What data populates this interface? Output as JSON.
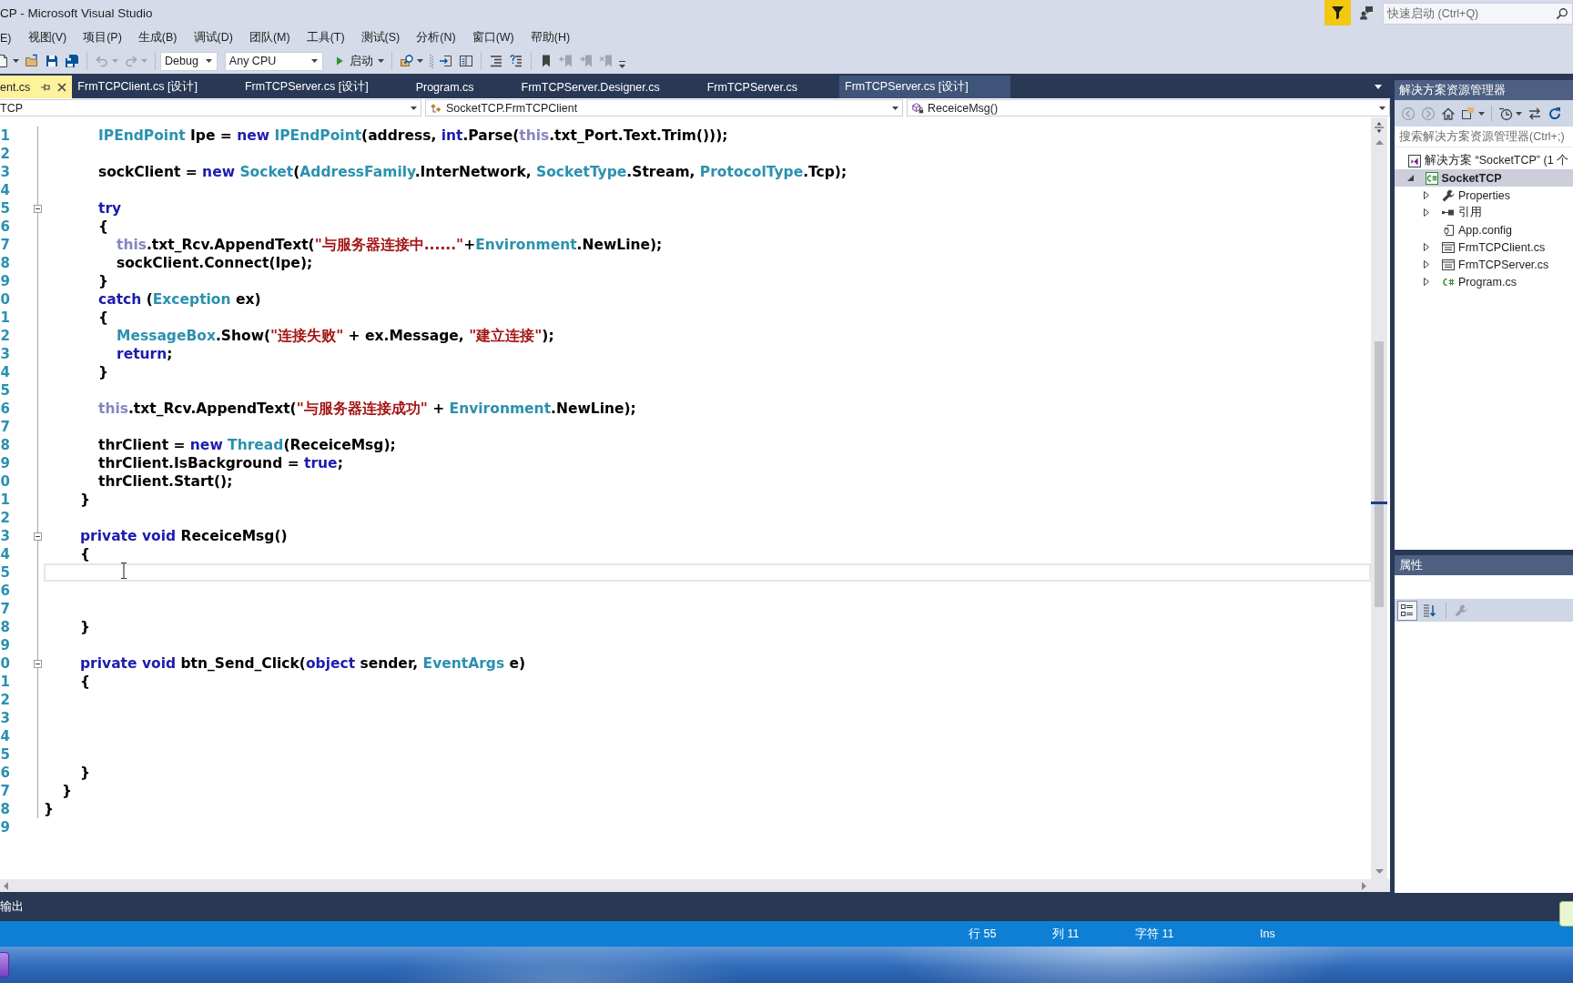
{
  "window": {
    "title": "CP - Microsoft Visual Studio"
  },
  "quick_launch": {
    "placeholder": "快速启动 (Ctrl+Q)"
  },
  "menu": [
    "E)",
    "视图(V)",
    "项目(P)",
    "生成(B)",
    "调试(D)",
    "团队(M)",
    "工具(T)",
    "测试(S)",
    "分析(N)",
    "窗口(W)",
    "帮助(H)"
  ],
  "toolbar": [
    [
      {
        "kind": "new",
        "dropdown": true,
        "disabled": false
      },
      {
        "kind": "open",
        "disabled": false
      },
      {
        "kind": "save",
        "disabled": false
      },
      {
        "kind": "saveall",
        "disabled": false
      }
    ],
    [
      {
        "kind": "undo",
        "dropdown": true,
        "disabled": true
      },
      {
        "kind": "redo",
        "dropdown": true,
        "disabled": true
      }
    ],
    [
      {
        "kind": "combo",
        "value": "Debug"
      },
      {
        "kind": "combo",
        "value": "Any CPU"
      },
      {
        "kind": "start",
        "label": "启动",
        "dropdown": true
      }
    ],
    [
      {
        "kind": "find",
        "dropdown": true,
        "disabled": false
      },
      {
        "kind": "grip"
      },
      {
        "kind": "stepin",
        "disabled": false
      },
      {
        "kind": "split",
        "disabled": false
      }
    ],
    [
      {
        "kind": "indent",
        "disabled": false
      },
      {
        "kind": "comment",
        "disabled": false
      }
    ],
    [
      {
        "kind": "bookmark",
        "disabled": false
      },
      {
        "kind": "bookmarkprev",
        "disabled": true
      },
      {
        "kind": "bookmarknext",
        "disabled": true
      },
      {
        "kind": "bookmarkclear",
        "disabled": true
      }
    ]
  ],
  "tabs": [
    {
      "label": "ent.cs",
      "selected": true,
      "hovered": false
    },
    {
      "label": "FrmTCPClient.cs [设计]",
      "selected": false,
      "hovered": false
    },
    {
      "label": "FrmTCPServer.cs [设计]",
      "selected": false,
      "hovered": false
    },
    {
      "label": "Program.cs",
      "selected": false,
      "hovered": false
    },
    {
      "label": "FrmTCPServer.Designer.cs",
      "selected": false,
      "hovered": false
    },
    {
      "label": "FrmTCPServer.cs",
      "selected": false,
      "hovered": false
    },
    {
      "label": "FrmTCPServer.cs [设计]",
      "selected": false,
      "hovered": true
    }
  ],
  "navigation": {
    "project": "TCP",
    "type": "SocketTCP.FrmTCPClient",
    "member": "ReceiceMsg()"
  },
  "editor": {
    "lines": [
      {
        "number": "1",
        "current": false,
        "tokens": [
          {
            "text": "\t\t\tIPEndPoint",
            "kind": "type"
          },
          {
            "text": " Ipe = ",
            "kind": "plain"
          },
          {
            "text": "new",
            "kind": "keyword"
          },
          {
            "text": " IPEndPoint",
            "kind": "type"
          },
          {
            "text": "(address, ",
            "kind": "plain"
          },
          {
            "text": "int",
            "kind": "keyword"
          },
          {
            "text": ".Parse(",
            "kind": "plain"
          },
          {
            "text": "this",
            "kind": "self"
          },
          {
            "text": ".txt_Port.Text.Trim()));",
            "kind": "plain"
          }
        ]
      },
      {
        "number": "2",
        "current": false
      },
      {
        "number": "3",
        "current": false,
        "tokens": [
          {
            "text": "\t\t\tsockClient = ",
            "kind": "plain"
          },
          {
            "text": "new",
            "kind": "keyword"
          },
          {
            "text": " Socket",
            "kind": "type"
          },
          {
            "text": "(",
            "kind": "plain"
          },
          {
            "text": "AddressFamily",
            "kind": "type"
          },
          {
            "text": ".InterNetwork, ",
            "kind": "plain"
          },
          {
            "text": "SocketType",
            "kind": "type"
          },
          {
            "text": ".Stream, ",
            "kind": "plain"
          },
          {
            "text": "ProtocolType",
            "kind": "type"
          },
          {
            "text": ".Tcp);",
            "kind": "plain"
          }
        ]
      },
      {
        "number": "4",
        "current": false
      },
      {
        "number": "5",
        "current": false,
        "expanded": true,
        "tokens": [
          {
            "text": "\t\t\ttry",
            "kind": "keyword"
          }
        ]
      },
      {
        "number": "6",
        "current": false,
        "tokens": [
          {
            "text": "\t\t\t{",
            "kind": "plain"
          }
        ]
      },
      {
        "number": "7",
        "current": false,
        "tokens": [
          {
            "text": "\t\t\t\tthis",
            "kind": "self"
          },
          {
            "text": ".txt_Rcv.AppendText(",
            "kind": "plain"
          },
          {
            "text": "\"与服务器连接中......\"",
            "kind": "string"
          },
          {
            "text": "+",
            "kind": "plain"
          },
          {
            "text": "Environment",
            "kind": "type"
          },
          {
            "text": ".NewLine);",
            "kind": "plain"
          }
        ]
      },
      {
        "number": "8",
        "current": false,
        "tokens": [
          {
            "text": "\t\t\t\tsockClient.Connect(Ipe);",
            "kind": "plain"
          }
        ]
      },
      {
        "number": "9",
        "current": false,
        "tokens": [
          {
            "text": "\t\t\t}",
            "kind": "plain"
          }
        ]
      },
      {
        "number": "0",
        "current": false,
        "tokens": [
          {
            "text": "\t\t\tcatch",
            "kind": "keyword"
          },
          {
            "text": " (",
            "kind": "plain"
          },
          {
            "text": "Exception",
            "kind": "type"
          },
          {
            "text": " ex)",
            "kind": "plain"
          }
        ]
      },
      {
        "number": "1",
        "current": false,
        "tokens": [
          {
            "text": "\t\t\t{",
            "kind": "plain"
          }
        ]
      },
      {
        "number": "2",
        "current": false,
        "tokens": [
          {
            "text": "\t\t\t\tMessageBox",
            "kind": "type"
          },
          {
            "text": ".Show(",
            "kind": "plain"
          },
          {
            "text": "\"连接失败\"",
            "kind": "string"
          },
          {
            "text": " + ex.Message, ",
            "kind": "plain"
          },
          {
            "text": "\"建立连接\"",
            "kind": "string"
          },
          {
            "text": ");",
            "kind": "plain"
          }
        ]
      },
      {
        "number": "3",
        "current": false,
        "tokens": [
          {
            "text": "\t\t\t\treturn",
            "kind": "keyword"
          },
          {
            "text": ";",
            "kind": "plain"
          }
        ]
      },
      {
        "number": "4",
        "current": false,
        "tokens": [
          {
            "text": "\t\t\t}",
            "kind": "plain"
          }
        ]
      },
      {
        "number": "5",
        "current": false
      },
      {
        "number": "6",
        "current": false,
        "tokens": [
          {
            "text": "\t\t\tthis",
            "kind": "self"
          },
          {
            "text": ".txt_Rcv.AppendText(",
            "kind": "plain"
          },
          {
            "text": "\"与服务器连接成功\"",
            "kind": "string"
          },
          {
            "text": " + ",
            "kind": "plain"
          },
          {
            "text": "Environment",
            "kind": "type"
          },
          {
            "text": ".NewLine);",
            "kind": "plain"
          }
        ]
      },
      {
        "number": "7",
        "current": false
      },
      {
        "number": "8",
        "current": false,
        "tokens": [
          {
            "text": "\t\t\tthrClient = ",
            "kind": "plain"
          },
          {
            "text": "new",
            "kind": "keyword"
          },
          {
            "text": " Thread",
            "kind": "type"
          },
          {
            "text": "(ReceiceMsg);",
            "kind": "plain"
          }
        ]
      },
      {
        "number": "9",
        "current": false,
        "tokens": [
          {
            "text": "\t\t\tthrClient.IsBackground = ",
            "kind": "plain"
          },
          {
            "text": "true",
            "kind": "keyword"
          },
          {
            "text": ";",
            "kind": "plain"
          }
        ]
      },
      {
        "number": "0",
        "current": false,
        "tokens": [
          {
            "text": "\t\t\tthrClient.Start();",
            "kind": "plain"
          }
        ]
      },
      {
        "number": "1",
        "current": false,
        "tokens": [
          {
            "text": "\t\t}",
            "kind": "plain"
          }
        ]
      },
      {
        "number": "2",
        "current": false
      },
      {
        "number": "3",
        "current": false,
        "expanded": true,
        "tokens": [
          {
            "text": "\t\tprivate",
            "kind": "keyword"
          },
          {
            "text": " void",
            "kind": "keyword"
          },
          {
            "text": " ReceiceMsg()",
            "kind": "plain"
          }
        ]
      },
      {
        "number": "4",
        "current": false,
        "tokens": [
          {
            "text": "\t\t{",
            "kind": "plain"
          }
        ]
      },
      {
        "number": "5",
        "current": true
      },
      {
        "number": "6",
        "current": false
      },
      {
        "number": "7",
        "current": false
      },
      {
        "number": "8",
        "current": false,
        "tokens": [
          {
            "text": "\t\t}",
            "kind": "plain"
          }
        ]
      },
      {
        "number": "9",
        "current": false
      },
      {
        "number": "0",
        "current": false,
        "expanded": true,
        "tokens": [
          {
            "text": "\t\tprivate",
            "kind": "keyword"
          },
          {
            "text": " void",
            "kind": "keyword"
          },
          {
            "text": " btn_Send_Click(",
            "kind": "plain"
          },
          {
            "text": "object",
            "kind": "keyword"
          },
          {
            "text": " sender, ",
            "kind": "plain"
          },
          {
            "text": "EventArgs",
            "kind": "type"
          },
          {
            "text": " e)",
            "kind": "plain"
          }
        ]
      },
      {
        "number": "1",
        "current": false,
        "tokens": [
          {
            "text": "\t\t{",
            "kind": "plain"
          }
        ]
      },
      {
        "number": "2",
        "current": false
      },
      {
        "number": "3",
        "current": false
      },
      {
        "number": "4",
        "current": false
      },
      {
        "number": "5",
        "current": false
      },
      {
        "number": "6",
        "current": false,
        "tokens": [
          {
            "text": "\t\t}",
            "kind": "plain"
          }
        ]
      },
      {
        "number": "7",
        "current": false,
        "tokens": [
          {
            "text": "\t}",
            "kind": "plain"
          }
        ]
      },
      {
        "number": "8",
        "current": false,
        "tokens": [
          {
            "text": "}",
            "kind": "plain"
          }
        ]
      },
      {
        "number": "9",
        "current": false
      }
    ]
  },
  "solution_explorer": {
    "title": "解决方案资源管理器",
    "toolbar": [
      [
        {
          "kind": "back",
          "disabled": true
        },
        {
          "kind": "forward",
          "disabled": true
        },
        {
          "kind": "home",
          "disabled": false
        },
        {
          "kind": "views",
          "disabled": false,
          "dropdown": true
        }
      ],
      [
        {
          "kind": "history",
          "disabled": false,
          "dropdown": true
        },
        {
          "kind": "sync",
          "disabled": false
        },
        {
          "kind": "refresh",
          "disabled": false
        }
      ]
    ],
    "search": {
      "placeholder": "搜索解决方案资源管理器(Ctrl+;)"
    },
    "tree": [
      {
        "label": "解决方案 “SocketTCP” (1 个",
        "kind": "solution",
        "selected": false,
        "children": [
          {
            "label": "SocketTCP",
            "kind": "project",
            "selected": true,
            "expanded": true,
            "children": [
              {
                "label": "Properties",
                "kind": "properties",
                "selected": false,
                "expanded": false
              },
              {
                "label": "引用",
                "kind": "references",
                "selected": false,
                "expanded": false
              },
              {
                "label": "App.config",
                "kind": "config",
                "selected": false
              },
              {
                "label": "FrmTCPClient.cs",
                "kind": "form",
                "selected": false,
                "expanded": false
              },
              {
                "label": "FrmTCPServer.cs",
                "kind": "form",
                "selected": false,
                "expanded": false
              },
              {
                "label": "Program.cs",
                "kind": "code",
                "selected": false,
                "expanded": false
              }
            ]
          }
        ]
      }
    ]
  },
  "properties": {
    "title": "属性",
    "toolbar": [
      [
        {
          "kind": "categorized",
          "selected": true
        },
        {
          "kind": "alphabetical",
          "selected": false
        }
      ],
      [
        {
          "kind": "pages",
          "disabled": true
        }
      ]
    ]
  },
  "output_tab": {
    "label": "输出"
  },
  "status_bar": {
    "line": "行 55",
    "column": "列 11",
    "character": "字符 11",
    "mode": "Ins"
  }
}
